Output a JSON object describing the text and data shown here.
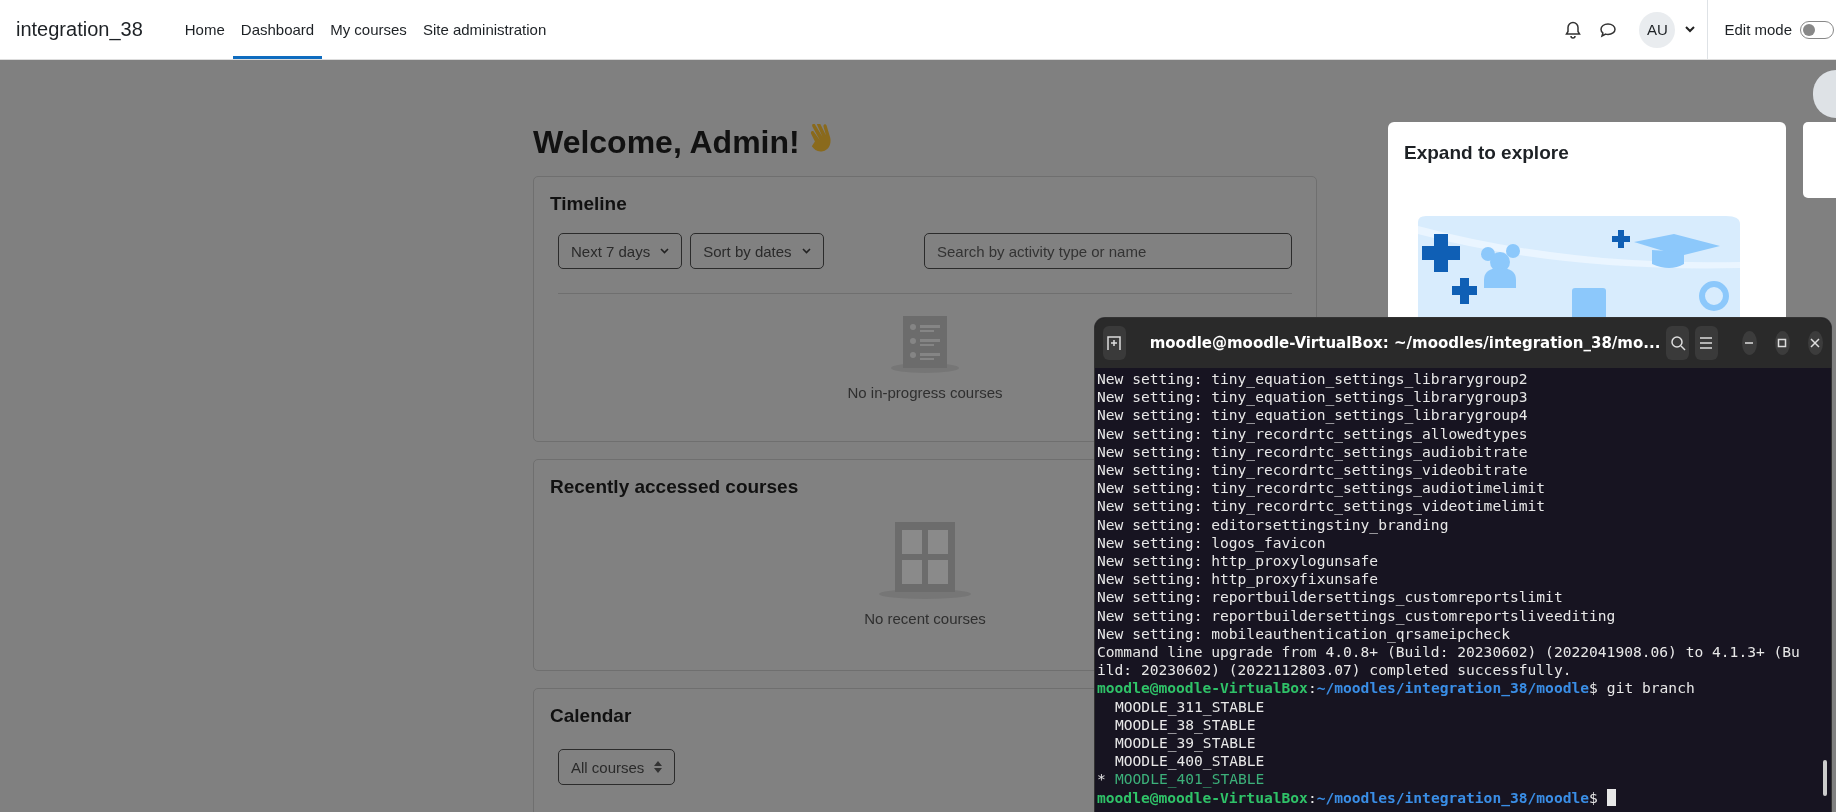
{
  "navbar": {
    "site_name": "integration_38",
    "links": [
      {
        "label": "Home",
        "selected": false
      },
      {
        "label": "Dashboard",
        "selected": true
      },
      {
        "label": "My courses",
        "selected": false
      },
      {
        "label": "Site administration",
        "selected": false
      }
    ],
    "avatar": {
      "initials": "AU"
    },
    "edit_mode": {
      "label": "Edit mode",
      "on": false
    }
  },
  "heading": "Welcome, Admin!",
  "timeline": {
    "title": "Timeline",
    "filters": [
      {
        "label": "Next 7 days"
      },
      {
        "label": "Sort by dates"
      }
    ],
    "search": {
      "placeholder": "Search by activity type or name"
    },
    "empty_message": "No in-progress courses"
  },
  "recent": {
    "title": "Recently accessed courses",
    "empty_message": "No recent courses"
  },
  "calendar": {
    "title": "Calendar",
    "course_filter": "All courses"
  },
  "tour_popup": {
    "title": "Expand to explore"
  },
  "terminal": {
    "title": "moodle@moodle-VirtualBox: ~/moodles/integration_38/mo...",
    "lines": [
      {
        "kind": "output",
        "text": "New setting: tiny_equation_settings_librarygroup2"
      },
      {
        "kind": "output",
        "text": "New setting: tiny_equation_settings_librarygroup3"
      },
      {
        "kind": "output",
        "text": "New setting: tiny_equation_settings_librarygroup4"
      },
      {
        "kind": "output",
        "text": "New setting: tiny_recordrtc_settings_allowedtypes"
      },
      {
        "kind": "output",
        "text": "New setting: tiny_recordrtc_settings_audiobitrate"
      },
      {
        "kind": "output",
        "text": "New setting: tiny_recordrtc_settings_videobitrate"
      },
      {
        "kind": "output",
        "text": "New setting: tiny_recordrtc_settings_audiotimelimit"
      },
      {
        "kind": "output",
        "text": "New setting: tiny_recordrtc_settings_videotimelimit"
      },
      {
        "kind": "output",
        "text": "New setting: editorsettingstiny_branding"
      },
      {
        "kind": "output",
        "text": "New setting: logos_favicon"
      },
      {
        "kind": "output",
        "text": "New setting: http_proxylogunsafe"
      },
      {
        "kind": "output",
        "text": "New setting: http_proxyfixunsafe"
      },
      {
        "kind": "output",
        "text": "New setting: reportbuildersettings_customreportslimit"
      },
      {
        "kind": "output",
        "text": "New setting: reportbuildersettings_customreportsliveediting"
      },
      {
        "kind": "output",
        "text": "New setting: mobileauthentication_qrsameipcheck"
      },
      {
        "kind": "output",
        "text": "Command line upgrade from 4.0.8+ (Build: 20230602) (2022041908.06) to 4.1.3+ (Bu"
      },
      {
        "kind": "output",
        "text": "ild: 20230602) (2022112803.07) completed successfully."
      },
      {
        "kind": "prompt",
        "user": "moodle@moodle-VirtualBox",
        "path": "~/moodles/integration_38/moodle",
        "separator": ":",
        "symbol": "$",
        "command": "git branch"
      },
      {
        "kind": "branch",
        "text": "MOODLE_311_STABLE",
        "current": false
      },
      {
        "kind": "branch",
        "text": "MOODLE_38_STABLE",
        "current": false
      },
      {
        "kind": "branch",
        "text": "MOODLE_39_STABLE",
        "current": false
      },
      {
        "kind": "branch",
        "text": "MOODLE_400_STABLE",
        "current": false
      },
      {
        "kind": "branch",
        "marker": "*",
        "text": "MOODLE_401_STABLE",
        "current": true
      },
      {
        "kind": "prompt",
        "user": "moodle@moodle-VirtualBox",
        "path": "~/moodles/integration_38/moodle",
        "separator": ":",
        "symbol": "$",
        "cursor": true
      }
    ]
  }
}
